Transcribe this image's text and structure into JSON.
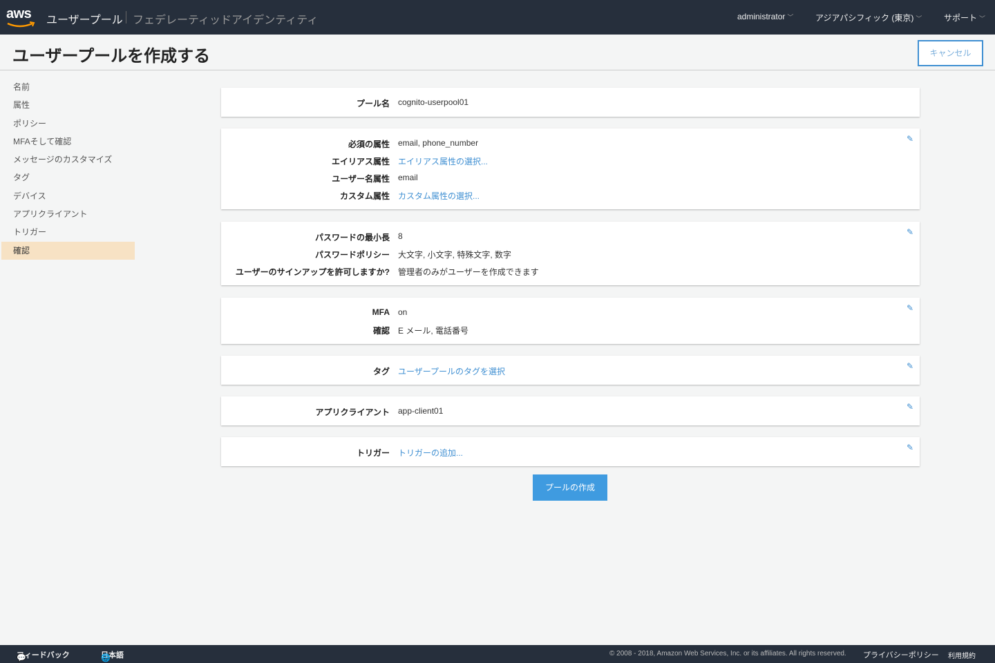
{
  "header": {
    "logo": "aws",
    "service": "ユーザープール",
    "federated": "フェデレーティッドアイデンティティ",
    "user": "administrator",
    "region": "アジアパシフィック (東京)",
    "support": "サポート"
  },
  "page": {
    "title": "ユーザープールを作成する",
    "cancel": "キャンセル"
  },
  "sidebar": {
    "items": [
      "名前",
      "属性",
      "ポリシー",
      "MFAそして確認",
      "メッセージのカスタマイズ",
      "タグ",
      "デバイス",
      "アプリクライアント",
      "トリガー",
      "確認"
    ]
  },
  "cards": [
    {
      "rows": [
        {
          "label": "プール名",
          "value": "cognito-userpool01"
        }
      ]
    },
    {
      "rows": [
        {
          "label": "必須の属性",
          "value": "email, phone_number"
        },
        {
          "label": "エイリアス属性",
          "value": "エイリアス属性の選択..."
        },
        {
          "label": "ユーザー名属性",
          "value": "email"
        },
        {
          "label": "カスタム属性",
          "value": "カスタム属性の選択..."
        }
      ]
    },
    {
      "rows": [
        {
          "label": "パスワードの最小長",
          "value": "8"
        },
        {
          "label": "パスワードポリシー",
          "value": "大文字, 小文字, 特殊文字, 数字"
        },
        {
          "label": "ユーザーのサインアップを許可しますか?",
          "value": "管理者のみがユーザーを作成できます"
        }
      ]
    },
    {
      "rows": [
        {
          "label": "MFA",
          "value": "on"
        },
        {
          "label": "確認",
          "value": "E メール, 電話番号"
        }
      ]
    },
    {
      "rows": [
        {
          "label": "タグ",
          "value": "ユーザープールのタグを選択"
        }
      ]
    },
    {
      "rows": [
        {
          "label": "アプリクライアント",
          "value": "app-client01"
        }
      ]
    },
    {
      "rows": [
        {
          "label": "トリガー",
          "value": "トリガーの追加..."
        }
      ]
    }
  ],
  "create_button": "プールの作成",
  "footer": {
    "feedback": "フィードバック",
    "language": "日本語",
    "copyright": "© 2008 - 2018, Amazon Web Services, Inc. or its affiliates. All rights reserved.",
    "privacy": "プライバシーポリシー",
    "terms": "利用規約"
  },
  "colors": {
    "header": "#262f3c",
    "accent": "#3f8fd2",
    "active": "#f7e2c4"
  }
}
